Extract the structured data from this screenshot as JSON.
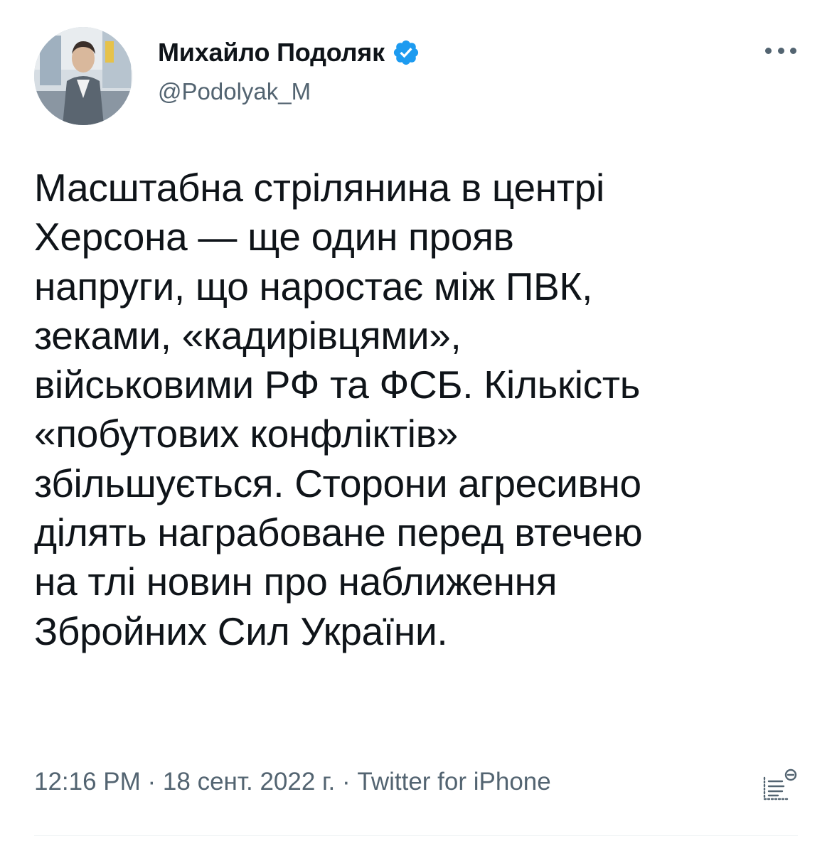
{
  "author": {
    "display_name": "Михайло Подоляк",
    "handle": "@Podolyak_M",
    "verified_icon": "verified-badge-icon",
    "avatar_icon": "avatar-photo"
  },
  "more_menu_icon": "more-dots-icon",
  "tweet": {
    "lines": [
      "Масштабна стрілянина в центрі",
      "Херсона — ще один прояв",
      "напруги, що наростає між ПВК,",
      "зеками, «кадирівцями»,",
      "військовими РФ та ФСБ. Кількість",
      "«побутових конфліктів»",
      "збільшується. Сторони агресивно",
      "ділять награбоване перед втечею",
      "на тлі новин про наближення",
      "Збройних Сил України."
    ]
  },
  "meta": {
    "time": "12:16 PM",
    "separator1": " · ",
    "date": "18 сент. 2022 г.",
    "separator2": " · ",
    "source": "Twitter for iPhone"
  },
  "analytics_icon": "analytics-icon",
  "colors": {
    "verified": "#1d9bf0",
    "text": "#0f1419",
    "secondary": "#536471"
  }
}
